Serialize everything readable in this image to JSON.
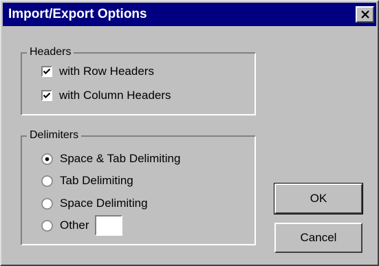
{
  "window": {
    "title": "Import/Export Options",
    "close_icon": "close-x-icon"
  },
  "headers_group": {
    "label": "Headers",
    "options": [
      {
        "label": "with Row Headers",
        "checked": true
      },
      {
        "label": "with Column Headers",
        "checked": true
      }
    ]
  },
  "delimiters_group": {
    "label": "Delimiters",
    "options": [
      {
        "label": "Space & Tab Delimiting",
        "selected": true
      },
      {
        "label": "Tab Delimiting",
        "selected": false
      },
      {
        "label": "Space Delimiting",
        "selected": false
      },
      {
        "label": "Other",
        "selected": false
      }
    ],
    "other_value": ""
  },
  "buttons": {
    "ok": "OK",
    "cancel": "Cancel"
  },
  "colors": {
    "title_bar": "#000080",
    "face": "#c0c0c0"
  }
}
